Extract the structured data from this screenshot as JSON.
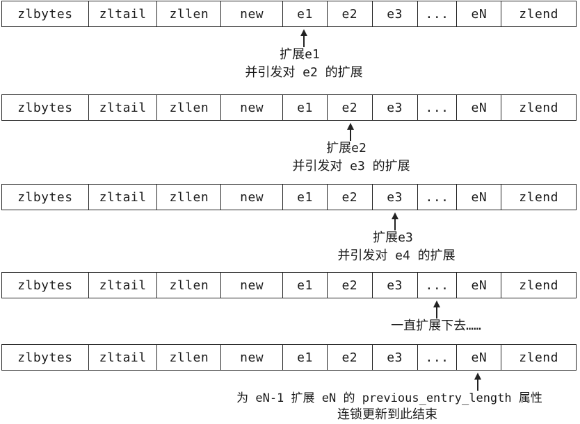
{
  "cells": [
    "zlbytes",
    "zltail",
    "zllen",
    "new",
    "e1",
    "e2",
    "e3",
    "...",
    "eN",
    "zlend"
  ],
  "stages": [
    {
      "line1": "扩展e1",
      "line2": "并引发对 e2 的扩展"
    },
    {
      "line1": "扩展e2",
      "line2": "并引发对 e3 的扩展"
    },
    {
      "line1": "扩展e3",
      "line2": "并引发对 e4 的扩展"
    },
    {
      "line1": "一直扩展下去……"
    },
    {
      "line1": "为 eN-1 扩展 eN 的 previous_entry_length 属性",
      "line2": "连锁更新到此结束"
    }
  ]
}
